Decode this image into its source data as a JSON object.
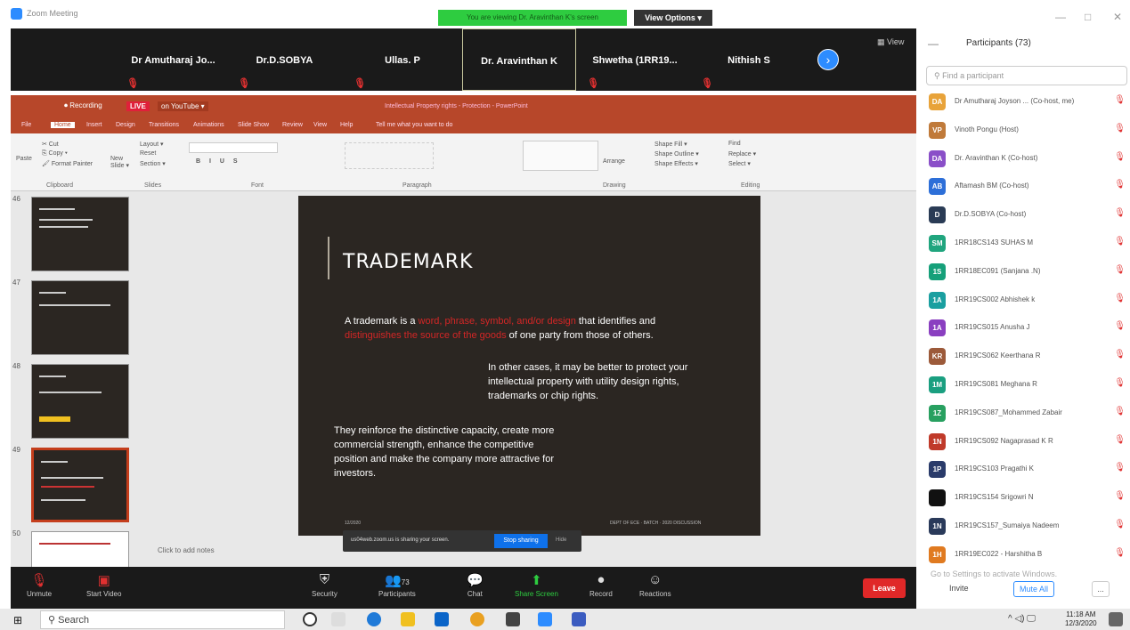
{
  "window": {
    "title": "Zoom Meeting",
    "viewing_banner": "You are viewing Dr. Aravinthan K's screen",
    "view_options": "View Options ▾",
    "min": "—",
    "max": "□",
    "close": "✕"
  },
  "strip": {
    "tiles": [
      "Dr Amutharaj Jo...",
      "Dr.D.SOBYA",
      "Ullas. P",
      "Dr. Aravinthan K",
      "Shwetha (1RR19...",
      "Nithish S"
    ],
    "view_label": "▦ View"
  },
  "ppt": {
    "rec_label": "⏺ Recording",
    "live": "LIVE",
    "youtube": "on YouTube ▾",
    "doc_title": "Intellectual Property rights - Protection - PowerPoint",
    "tabs": [
      "File",
      "Home",
      "Insert",
      "Design",
      "Transitions",
      "Animations",
      "Slide Show",
      "Review",
      "View",
      "Help",
      "Tell me what you want to do"
    ],
    "groups": [
      "Clipboard",
      "Slides",
      "Font",
      "Paragraph",
      "Drawing",
      "Editing"
    ],
    "ribbon": {
      "cut": "✂ Cut",
      "copy": "⎘ Copy ▾",
      "painter": "🖌 Format Painter",
      "paste": "Paste",
      "new_slide": "New Slide ▾",
      "layout": "Layout ▾",
      "reset": "Reset",
      "section": "Section ▾",
      "find": "Find",
      "replace": "Replace ▾",
      "select": "Select ▾",
      "arrange": "Arrange",
      "shape_fill": "Shape Fill ▾",
      "shape_outline": "Shape Outline ▾",
      "shape_effects": "Shape Effects ▾"
    },
    "thumb_numbers": [
      "46",
      "47",
      "48",
      "49",
      "50"
    ],
    "slide": {
      "title": "TRADEMARK",
      "p1_pre": "A trademark is a ",
      "p1_red1": "word, phrase, symbol, and/or design",
      "p1_mid": " that identifies and ",
      "p1_red2": "distinguishes the source of the goods",
      "p1_post": " of one party from those of others.",
      "p2": "In other cases, it may be better to protect your intellectual property with utility design rights, trademarks or chip rights.",
      "p3": "They reinforce the distinctive capacity, create more commercial strength, enhance the competitive position and make the company more attractive for investors.",
      "footer_left": "12/2020",
      "footer_right": "DEPT OF ECE · BATCH · 2020 DISCUSSION"
    },
    "notes": "Click to add notes",
    "share": {
      "text": "us04web.zoom.us is sharing your screen.",
      "stop": "Stop sharing",
      "hide": "Hide"
    }
  },
  "toolbar": {
    "unmute": "Unmute",
    "start_video": "Start Video",
    "security": "Security",
    "participants": "Participants",
    "participants_count": "73",
    "chat": "Chat",
    "share_screen": "Share Screen",
    "record": "Record",
    "reactions": "Reactions",
    "leave": "Leave"
  },
  "panel": {
    "title": "Participants (73)",
    "search_placeholder": "Find a participant",
    "list": [
      {
        "initials": "DA",
        "name": "Dr Amutharaj Joyson ... (Co-host, me)",
        "color": "#e8a33a"
      },
      {
        "initials": "VP",
        "name": "Vinoth Pongu (Host)",
        "color": "#c07a3a"
      },
      {
        "initials": "DA",
        "name": "Dr. Aravinthan K (Co-host)",
        "color": "#8a4fc8"
      },
      {
        "initials": "AB",
        "name": "Aftamash BM (Co-host)",
        "color": "#2d6fd8"
      },
      {
        "initials": "D",
        "name": "Dr.D.SOBYA (Co-host)",
        "color": "#2a3b55"
      },
      {
        "initials": "SM",
        "name": "1RR18CS143 SUHAS M",
        "color": "#20a57e"
      },
      {
        "initials": "1S",
        "name": "1RR18EC091 (Sanjana .N)",
        "color": "#16a07a"
      },
      {
        "initials": "1A",
        "name": "1RR19CS002 Abhishek k",
        "color": "#1a9fa0"
      },
      {
        "initials": "1A",
        "name": "1RR19CS015 Anusha J",
        "color": "#8a3fc0"
      },
      {
        "initials": "KR",
        "name": "1RR19CS062 Keerthana R",
        "color": "#9c5a3a"
      },
      {
        "initials": "1M",
        "name": "1RR19CS081 Meghana R",
        "color": "#1a9f80"
      },
      {
        "initials": "1Z",
        "name": "1RR19CS087_Mohammed Zabair",
        "color": "#28a060"
      },
      {
        "initials": "1N",
        "name": "1RR19CS092 Nagaprasad K R",
        "color": "#c03a2a"
      },
      {
        "initials": "1P",
        "name": "1RR19CS103 Pragathi K",
        "color": "#2a3b6a"
      },
      {
        "initials": "",
        "name": "1RR19CS154 Srigowri N",
        "color": "#111111"
      },
      {
        "initials": "1N",
        "name": "1RR19CS157_Sumaiya Nadeem",
        "color": "#2a3a5a"
      },
      {
        "initials": "1H",
        "name": "1RR19EC022 - Harshitha B",
        "color": "#e07a20"
      }
    ],
    "watermark": "Go to Settings to activate Windows.",
    "invite": "Invite",
    "mute_all": "Mute All",
    "more": "..."
  },
  "taskbar": {
    "search": "Search",
    "time": "11:18 AM",
    "date": "12/3/2020",
    "tray": "^ ◁) 🖵"
  }
}
